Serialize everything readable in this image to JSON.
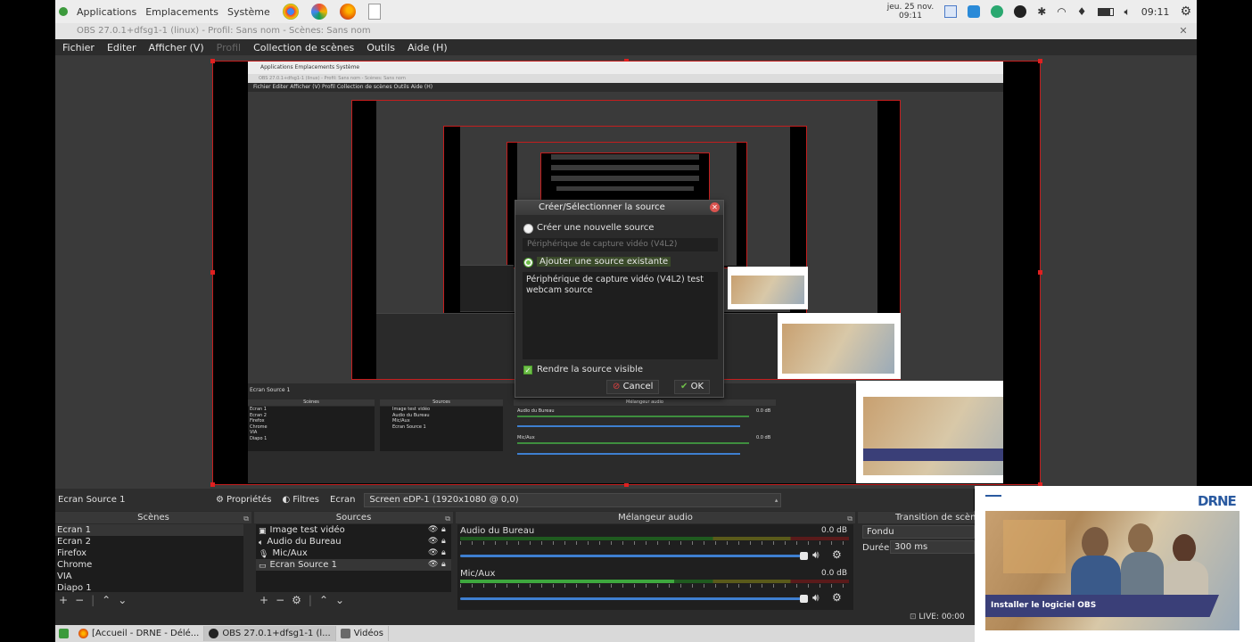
{
  "top_panel": {
    "applications": "Applications",
    "places": "Emplacements",
    "system": "Système",
    "date": "jeu. 25 nov.",
    "time_small": "09:11",
    "clock": "09:11"
  },
  "window": {
    "title": "OBS 27.0.1+dfsg1-1 (linux) - Profil: Sans nom - Scènes: Sans nom"
  },
  "menubar": {
    "items": [
      "Fichier",
      "Editer",
      "Afficher (V)",
      "Profil",
      "Collection de scènes",
      "Outils",
      "Aide (H)"
    ]
  },
  "nested": {
    "panel": "Applications   Emplacements   Système",
    "title": "OBS 27.0.1+dfsg1-1 (linux) - Profil: Sans nom - Scènes: Sans nom",
    "menu": "Fichier   Editer   Afficher (V)   Profil   Collection de scènes   Outils   Aide (H)",
    "source_name": "Ecran Source 1",
    "scenes_header": "Scènes",
    "sources_header": "Sources",
    "mixer_header": "Mélangeur audio",
    "scenes": [
      "Ecran 1",
      "Ecran 2",
      "Firefox",
      "Chrome",
      "VIA",
      "Diapo 1"
    ],
    "sources": [
      "Image test vidéo",
      "Audio du Bureau",
      "Mic/Aux",
      "Ecran Source 1"
    ],
    "mixer_tracks": [
      "Audio du Bureau",
      "Mic/Aux"
    ],
    "db": "0.0 dB"
  },
  "dialog": {
    "title": "Créer/Sélectionner la source",
    "create_new": "Créer une nouvelle source",
    "device_placeholder": "Périphérique de capture vidéo (V4L2)",
    "add_existing": "Ajouter une source existante",
    "existing_item_line1": "Périphérique de capture vidéo (V4L2) test",
    "existing_item_line2": "webcam source",
    "make_visible": "Rendre la source visible",
    "cancel": "Cancel",
    "ok": "OK"
  },
  "source_bar": {
    "name": "Ecran Source 1",
    "properties": "Propriétés",
    "filters": "Filtres",
    "screen_label": "Ecran",
    "screen_value": "Screen eDP-1 (1920x1080 @ 0,0)"
  },
  "scenes": {
    "header": "Scènes",
    "items": [
      "Ecran 1",
      "Ecran 2",
      "Firefox",
      "Chrome",
      "VIA",
      "Diapo 1"
    ]
  },
  "sources": {
    "header": "Sources",
    "items": [
      "Image test vidéo",
      "Audio du Bureau",
      "Mic/Aux",
      "Ecran Source 1"
    ]
  },
  "mixer": {
    "header": "Mélangeur audio",
    "tracks": [
      {
        "name": "Audio du Bureau",
        "db": "0.0 dB",
        "level": 0.0
      },
      {
        "name": "Mic/Aux",
        "db": "0.0 dB",
        "level": 0.55
      }
    ]
  },
  "transition": {
    "header": "Transition de scène",
    "type": "Fondu",
    "duration_label": "Durée",
    "duration_value": "300 ms"
  },
  "status": {
    "live": "LIVE: 00:00"
  },
  "webcam": {
    "logo": "DRNE",
    "banner": "Installer le logiciel OBS"
  },
  "taskbar": {
    "tasks": [
      "[Accueil - DRNE - Délé...",
      "OBS 27.0.1+dfsg1-1 (l...",
      "Vidéos"
    ]
  },
  "colors": {
    "accent_red": "#c41e1e",
    "meter_green": "#3ea83e",
    "meter_yellow": "#9a9a2a",
    "slider_blue": "#3e7fd0"
  }
}
